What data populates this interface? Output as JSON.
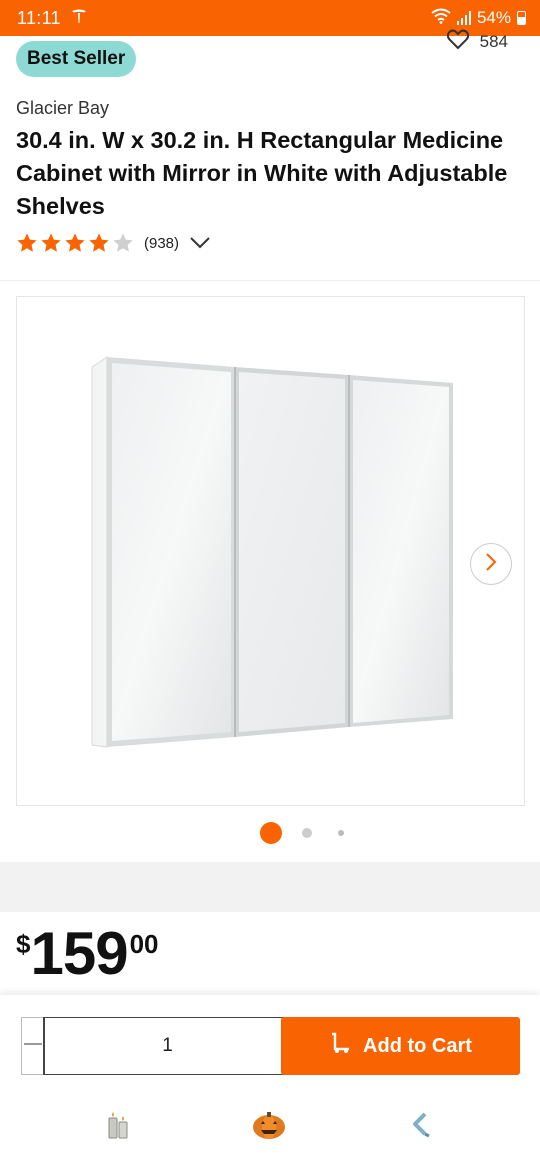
{
  "status_bar": {
    "time": "11:11",
    "app_icon": "tesla-logo-icon",
    "battery": "54%"
  },
  "badge": {
    "label": "Best Seller"
  },
  "favorites": {
    "count": "584",
    "icon": "heart-outline-icon"
  },
  "product": {
    "brand": "Glacier Bay",
    "title": "30.4 in. W x 30.2 in. H Rectangular Medicine Cabinet with Mirror in White with Adjustable Shelves",
    "rating": {
      "stars": 4,
      "max": 5,
      "count_text": "(938)"
    }
  },
  "gallery": {
    "image_icon": "medicine-cabinet-mirror-image",
    "next_icon": "chevron-right-icon",
    "pages": 3,
    "active_index": 0
  },
  "price": {
    "currency": "$",
    "dollars": "159",
    "cents": "00"
  },
  "cart": {
    "quantity": "1",
    "decrement_icon": "minus-icon",
    "increment_icon": "plus-icon",
    "add_label": "Add to Cart",
    "add_icon": "hand-truck-icon"
  },
  "bottom_nav": [
    {
      "icon": "candles-icon"
    },
    {
      "icon": "pumpkin-icon"
    },
    {
      "icon": "bracket-hook-icon"
    }
  ],
  "colors": {
    "brand_orange": "#f96302",
    "badge_teal": "#8dd9d3",
    "band_grey": "#f2f2f2"
  }
}
